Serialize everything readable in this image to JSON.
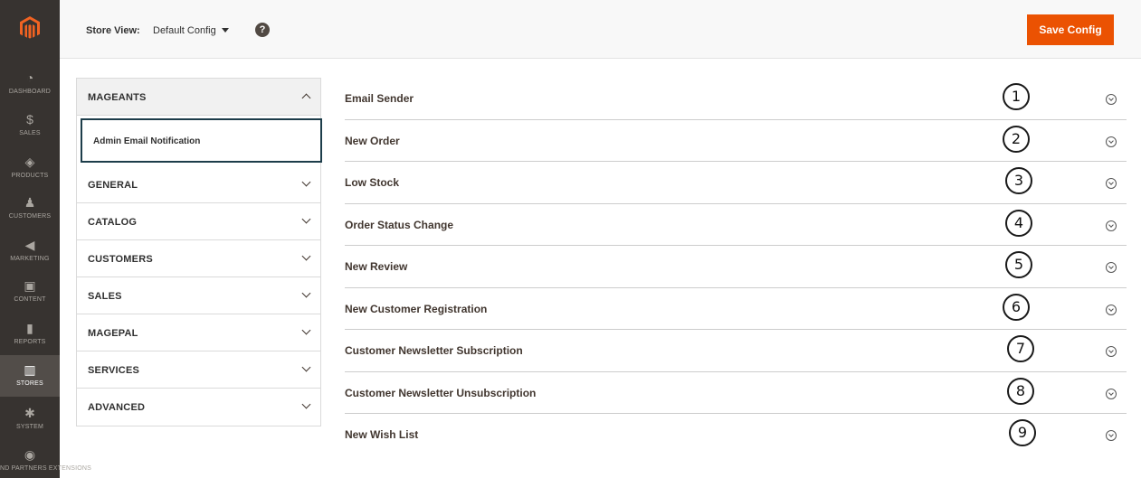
{
  "admin_nav": {
    "logo_icon": "magento-logo-icon",
    "items": [
      {
        "label": "DASHBOARD",
        "icon": "dashboard-icon",
        "glyph": "◔"
      },
      {
        "label": "SALES",
        "icon": "dollar-icon",
        "glyph": "$"
      },
      {
        "label": "PRODUCTS",
        "icon": "box-icon",
        "glyph": "◈"
      },
      {
        "label": "CUSTOMERS",
        "icon": "person-icon",
        "glyph": "♟"
      },
      {
        "label": "MARKETING",
        "icon": "megaphone-icon",
        "glyph": "◀"
      },
      {
        "label": "CONTENT",
        "icon": "layout-icon",
        "glyph": "▣"
      },
      {
        "label": "REPORTS",
        "icon": "bar-chart-icon",
        "glyph": "▮"
      },
      {
        "label": "STORES",
        "icon": "storefront-icon",
        "glyph": "▥"
      },
      {
        "label": "SYSTEM",
        "icon": "gear-icon",
        "glyph": "✱"
      },
      {
        "label": "ND PARTNERS EXTENSIONS",
        "icon": "partners-icon",
        "glyph": "◉"
      }
    ]
  },
  "topbar": {
    "store_view_label": "Store View:",
    "store_view_value": "Default Config",
    "help_glyph": "?",
    "save_label": "Save Config"
  },
  "tabs": {
    "open_group": {
      "title": "MAGEANTS",
      "item": "Admin Email Notification"
    },
    "groups": [
      "GENERAL",
      "CATALOG",
      "CUSTOMERS",
      "SALES",
      "MAGEPAL",
      "SERVICES",
      "ADVANCED"
    ]
  },
  "sections": [
    {
      "title": "Email Sender",
      "number": "1"
    },
    {
      "title": "New Order",
      "number": "2"
    },
    {
      "title": "Low Stock",
      "number": "3"
    },
    {
      "title": "Order Status Change",
      "number": "4"
    },
    {
      "title": "New Review",
      "number": "5"
    },
    {
      "title": "New Customer Registration",
      "number": "6"
    },
    {
      "title": "Customer Newsletter Subscription",
      "number": "7"
    },
    {
      "title": "Customer Newsletter Unsubscription",
      "number": "8"
    },
    {
      "title": "New Wish List",
      "number": "9"
    }
  ],
  "colors": {
    "nav_bg": "#373330",
    "accent": "#eb5202",
    "active_item_border": "#1d3d4a"
  }
}
